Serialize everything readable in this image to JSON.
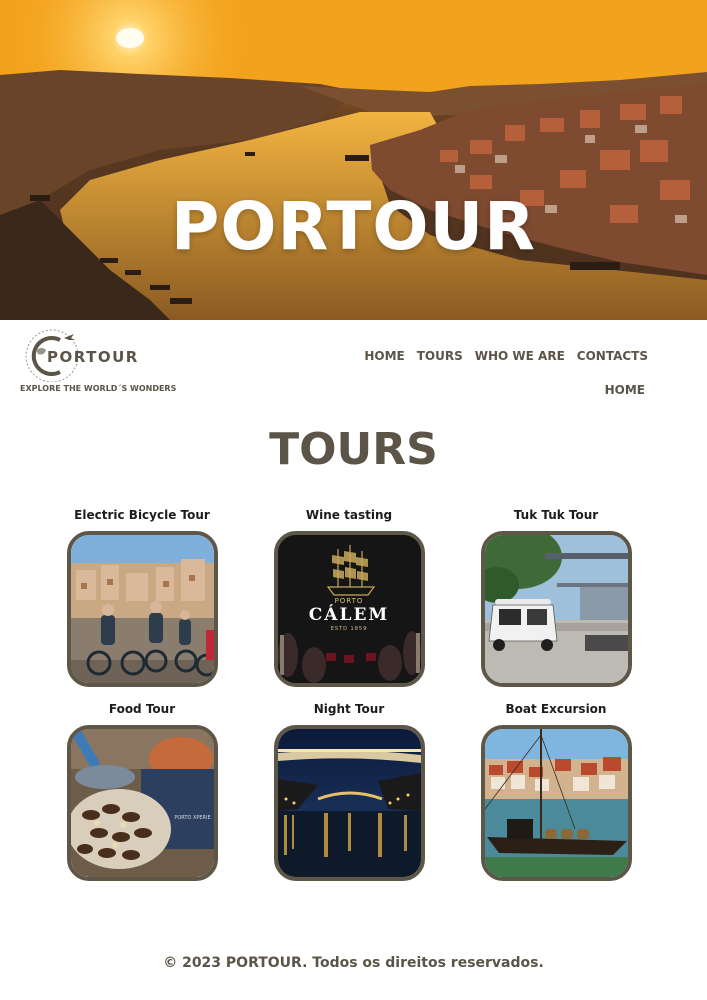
{
  "hero": {
    "title": "PORTOUR"
  },
  "logo": {
    "wordmark": "PORTOUR",
    "tagline": "EXPLORE THE WORLD´S WONDERS",
    "icon": "globe-plane-icon"
  },
  "nav": {
    "items": [
      "HOME",
      "TOURS",
      "WHO WE ARE",
      "CONTACTS"
    ]
  },
  "breadcrumb": "HOME",
  "section": {
    "title": "TOURS"
  },
  "tours": [
    {
      "name": "Electric Bicycle Tour"
    },
    {
      "name": "Wine tasting",
      "sign": "PORTO",
      "brand": "CÁLEM",
      "est": "ESTD 1859"
    },
    {
      "name": "Tuk Tuk Tour"
    },
    {
      "name": "Food Tour",
      "label": "PORTO XPERIE"
    },
    {
      "name": "Night Tour"
    },
    {
      "name": "Boat Excursion"
    }
  ],
  "footer": {
    "text": "© 2023 PORTOUR. Todos os direitos reservados."
  },
  "colors": {
    "text": "#5b5447",
    "border": "#5e5647",
    "sunset": "#f5a623",
    "white": "#ffffff"
  }
}
